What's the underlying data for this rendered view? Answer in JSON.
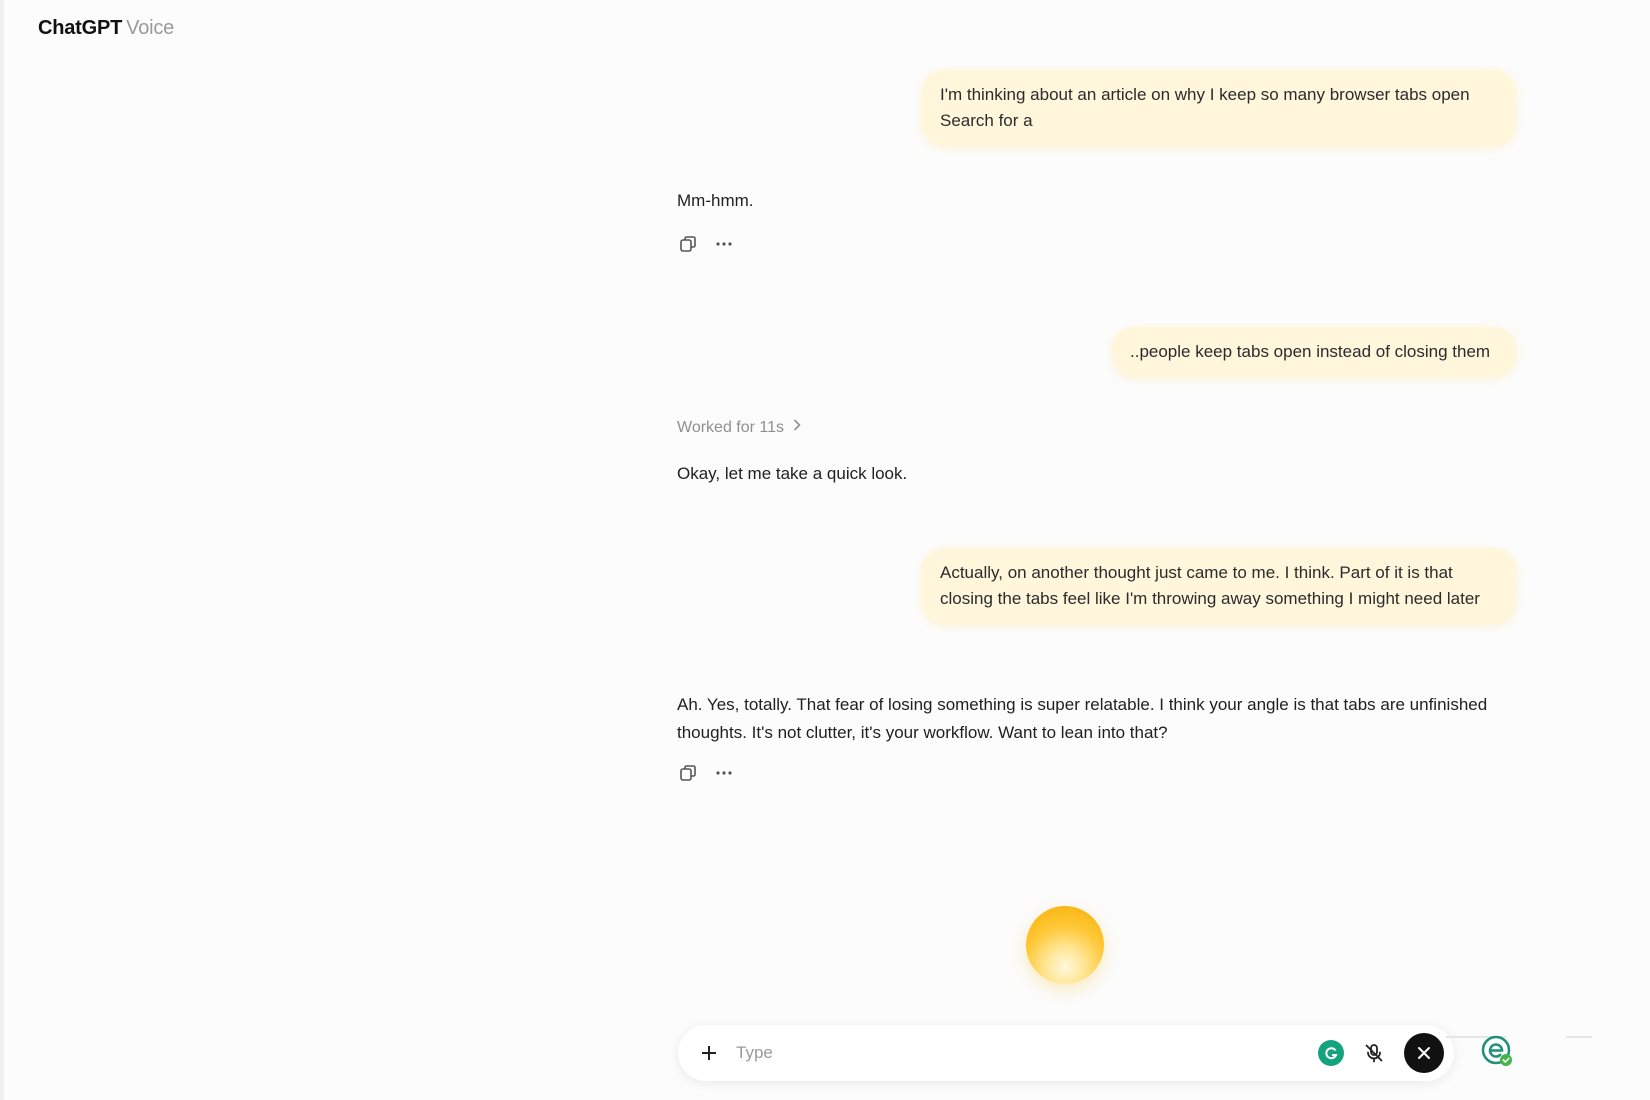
{
  "header": {
    "app_name": "ChatGPT",
    "mode": "Voice"
  },
  "messages": [
    {
      "role": "user",
      "text": "I'm thinking about an article on why I keep so many browser tabs open Search for a"
    },
    {
      "role": "assistant",
      "text": "Mm-hmm."
    },
    {
      "role": "user",
      "text": "..people keep tabs open instead of closing them"
    },
    {
      "role": "assistant",
      "status": "Worked for 11s",
      "text": "Okay, let me take a quick look."
    },
    {
      "role": "user",
      "text": "Actually, on another thought just came to me. I think. Part of it is that closing the tabs feel like I'm throwing away something I might need later"
    },
    {
      "role": "assistant",
      "text": "Ah. Yes, totally. That fear of losing something is super relatable. I think your angle is that tabs are unfinished thoughts. It's not clutter, it's your workflow. Want to lean into that?"
    }
  ],
  "composer": {
    "placeholder": "Type",
    "value": ""
  },
  "icons": {
    "copy": "copy-icon",
    "more": "more-horizontal-icon",
    "chevron": "chevron-right-icon",
    "plus": "plus-icon",
    "grammarly": "grammarly-icon",
    "mic_off": "mic-off-icon",
    "close": "close-icon",
    "extension": "extension-shield-icon"
  },
  "colors": {
    "user_bubble": "#fff6dc",
    "orb": "#ffc93a",
    "grammarly": "#15a37f",
    "close_button": "#111111"
  }
}
